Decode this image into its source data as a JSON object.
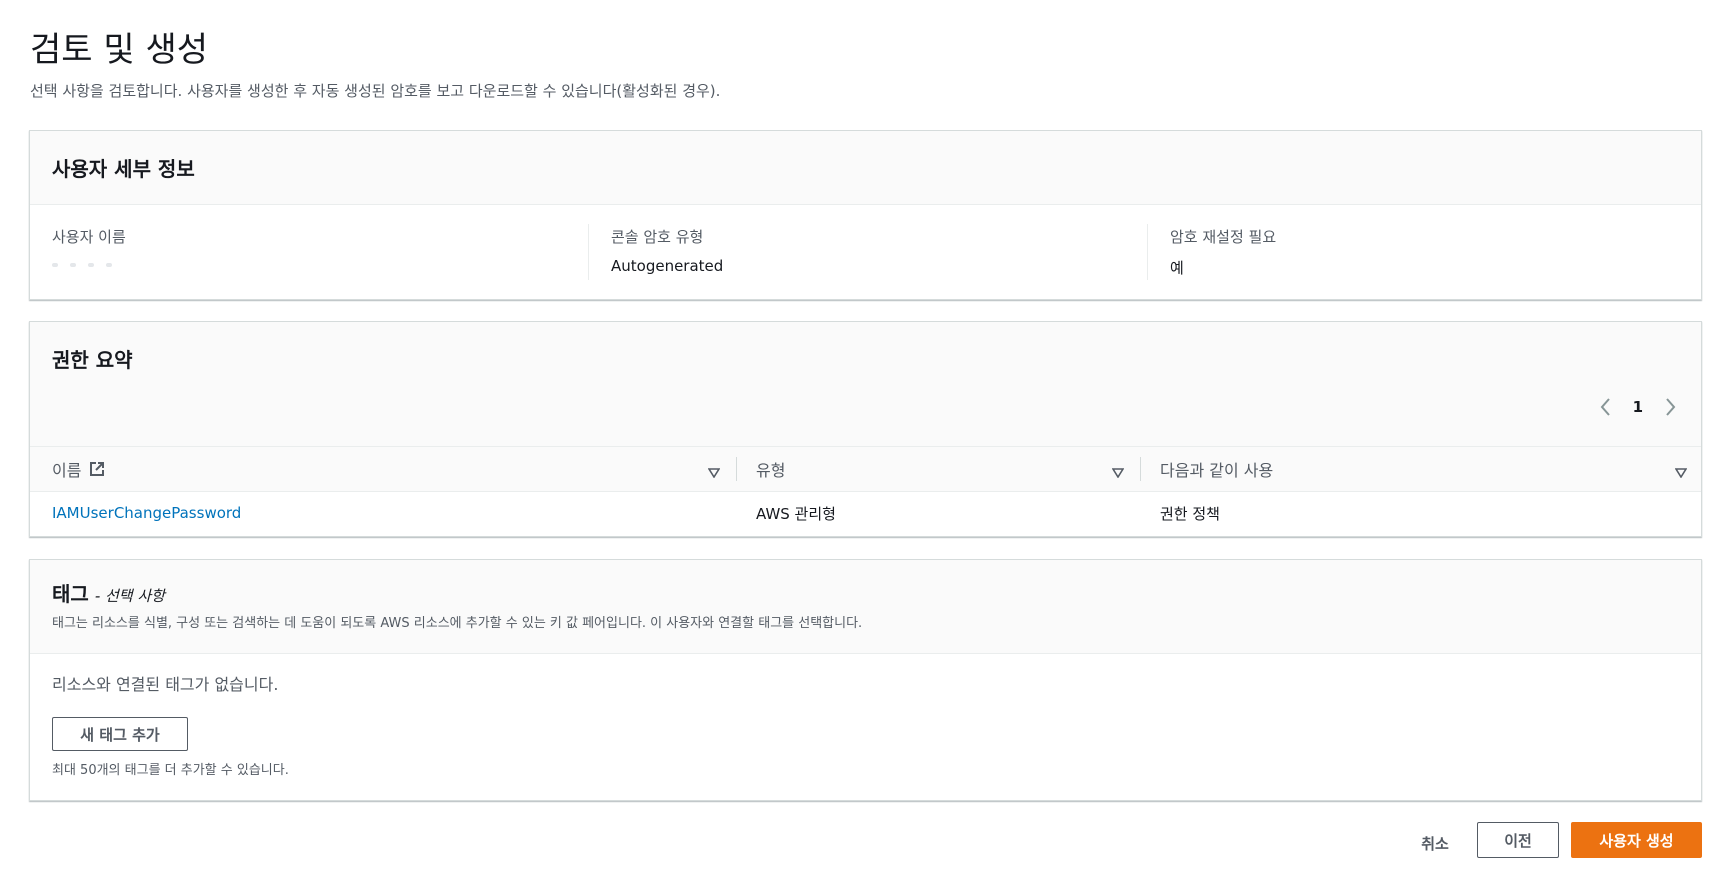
{
  "page": {
    "title": "검토 및 생성",
    "description": "선택 사항을 검토합니다. 사용자를 생성한 후 자동 생성된 암호를 보고 다운로드할 수 있습니다(활성화된 경우)."
  },
  "user_details": {
    "title": "사용자 세부 정보",
    "fields": [
      {
        "label": "사용자 이름",
        "value": ""
      },
      {
        "label": "콘솔 암호 유형",
        "value": "Autogenerated"
      },
      {
        "label": "암호 재설정 필요",
        "value": "예"
      }
    ]
  },
  "permissions": {
    "title": "권한 요약",
    "page_number": "1",
    "columns": [
      "이름",
      "유형",
      "다음과 같이 사용"
    ],
    "rows": [
      {
        "name": "IAMUserChangePassword",
        "type": "AWS 관리형",
        "used_as": "권한 정책"
      }
    ]
  },
  "tags": {
    "title": "태그",
    "optional_label": "- 선택 사항",
    "description": "태그는 리소스를 식별, 구성 또는 검색하는 데 도움이 되도록 AWS 리소스에 추가할 수 있는 키 값 페어입니다. 이 사용자와 연결할 태그를 선택합니다.",
    "empty_text": "리소스와 연결된 태그가 없습니다.",
    "add_button": "새 태그 추가",
    "limit_hint": "최대 50개의 태그를 더 추가할 수 있습니다."
  },
  "footer": {
    "cancel": "취소",
    "previous": "이전",
    "create": "사용자 생성"
  },
  "colors": {
    "primary": "#ec7211",
    "link": "#0073bb",
    "text": "#16191f",
    "muted": "#545b64"
  },
  "icons": [
    "external-link-icon",
    "sort-caret-icon",
    "chevron-left-icon",
    "chevron-right-icon"
  ]
}
